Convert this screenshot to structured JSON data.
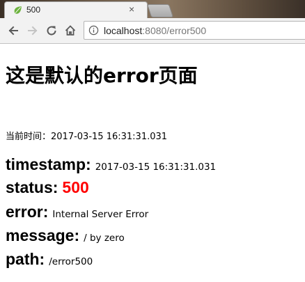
{
  "tab": {
    "title": "500",
    "close_glyph": "×",
    "favicon": "spring-leaf-icon"
  },
  "toolbar": {
    "back_icon": "back-arrow-icon",
    "forward_icon": "forward-arrow-icon",
    "reload_icon": "reload-icon",
    "home_icon": "home-icon",
    "url_host": "localhost",
    "url_rest": ":8080/error500",
    "info_icon": "info-icon"
  },
  "page": {
    "heading": "这是默认的error页面",
    "time_label": "当前时间：",
    "time_value": "2017-03-15 16:31:31.031",
    "fields": {
      "timestamp": {
        "label": "timestamp:",
        "value": "2017-03-15 16:31:31.031"
      },
      "status": {
        "label": "status:",
        "value": "500"
      },
      "error": {
        "label": "error:",
        "value": "Internal Server Error"
      },
      "message": {
        "label": "message:",
        "value": "/ by zero"
      },
      "path": {
        "label": "path:",
        "value": "/error500"
      }
    }
  },
  "colors": {
    "status_value": "#ff0000",
    "leaf_green": "#6db33f"
  }
}
